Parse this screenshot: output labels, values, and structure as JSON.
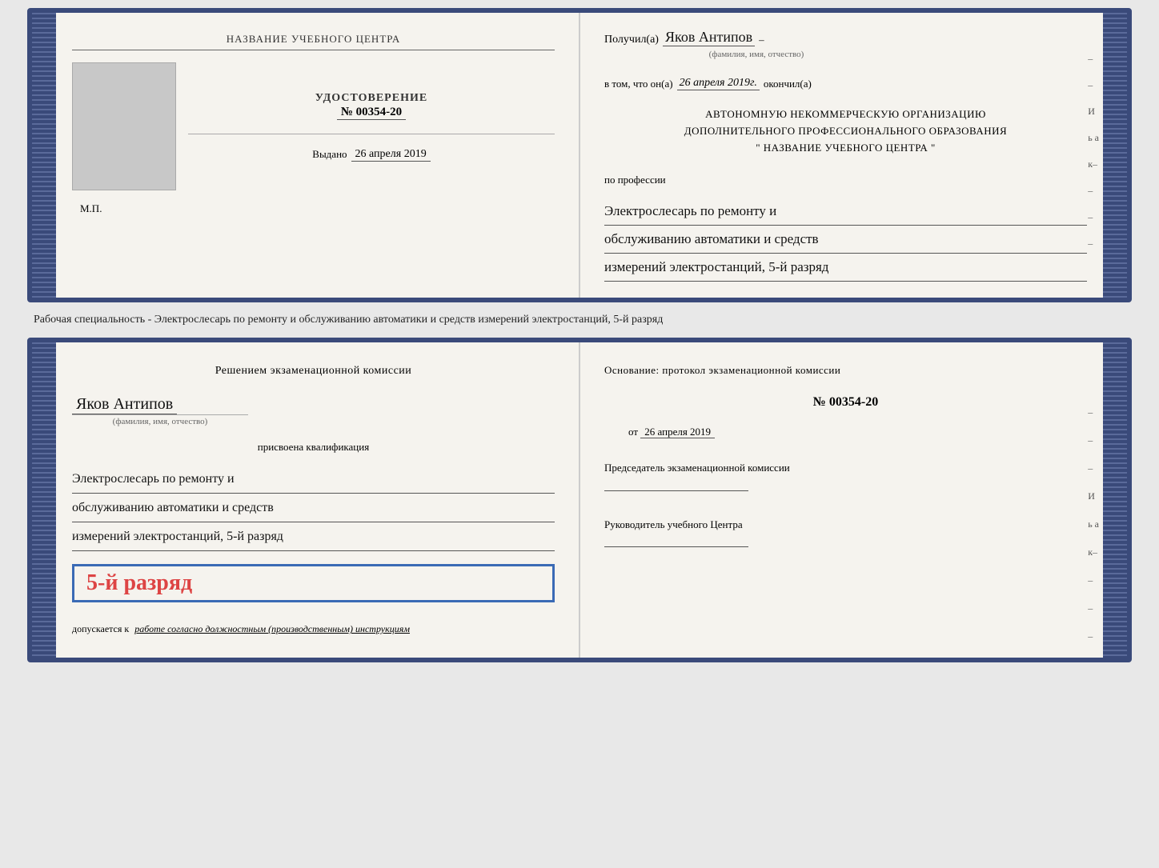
{
  "top_book": {
    "left": {
      "title": "НАЗВАНИЕ УЧЕБНОГО ЦЕНТРА",
      "cert_label": "УДОСТОВЕРЕНИЕ",
      "cert_number": "№ 00354-20",
      "vydano_label": "Выдано",
      "vydano_date": "26 апреля 2019",
      "mp_label": "М.П."
    },
    "right": {
      "poluchil_label": "Получил(а)",
      "fio_handwritten": "Яков Антипов",
      "fio_sublabel": "(фамилия, имя, отчество)",
      "vtom_prefix": "в том, что он(а)",
      "vtom_date": "26 апреля 2019г.",
      "okonchil_label": "окончил(а)",
      "org_line1": "АВТОНОМНУЮ НЕКОММЕРЧЕСКУЮ ОРГАНИЗАЦИЮ",
      "org_line2": "ДОПОЛНИТЕЛЬНОГО ПРОФЕССИОНАЛЬНОГО ОБРАЗОВАНИЯ",
      "org_quote_open": "\"",
      "org_name": "НАЗВАНИЕ УЧЕБНОГО ЦЕНТРА",
      "org_quote_close": "\"",
      "po_professii_label": "по профессии",
      "profession_line1": "Электрослесарь по ремонту и",
      "profession_line2": "обслуживанию автоматики и средств",
      "profession_line3": "измерений электростанций, 5-й разряд",
      "side_letters": [
        "–",
        "–",
        "И",
        "ь а",
        "к–",
        "–",
        "–",
        "–"
      ]
    }
  },
  "middle_text": "Рабочая специальность - Электрослесарь по ремонту и обслуживанию автоматики и средств измерений электростанций, 5-й разряд",
  "bottom_book": {
    "left": {
      "resheniem_title": "Решением  экзаменационной  комиссии",
      "fio_handwritten": "Яков Антипов",
      "fio_sublabel": "(фамилия, имя, отчество)",
      "prisvoena_text": "присвоена квалификация",
      "qual_line1": "Электрослесарь по ремонту и",
      "qual_line2": "обслуживанию автоматики и средств",
      "qual_line3": "измерений электростанций, 5-й разряд",
      "grade_text": "5-й разряд",
      "dopuskaetsya_prefix": "допускается к",
      "dopuskaetsya_value": "работе согласно должностным (производственным) инструкциям"
    },
    "right": {
      "osnovaniye_label": "Основание:  протокол  экзаменационной  комиссии",
      "protocol_number": "№  00354-20",
      "ot_label": "от",
      "ot_date": "26 апреля 2019",
      "chairman_label": "Председатель экзаменационной комиссии",
      "rukovoditel_label": "Руководитель учебного Центра",
      "side_letters": [
        "–",
        "–",
        "–",
        "И",
        "ь а",
        "к–",
        "–",
        "–",
        "–",
        "–"
      ]
    }
  }
}
